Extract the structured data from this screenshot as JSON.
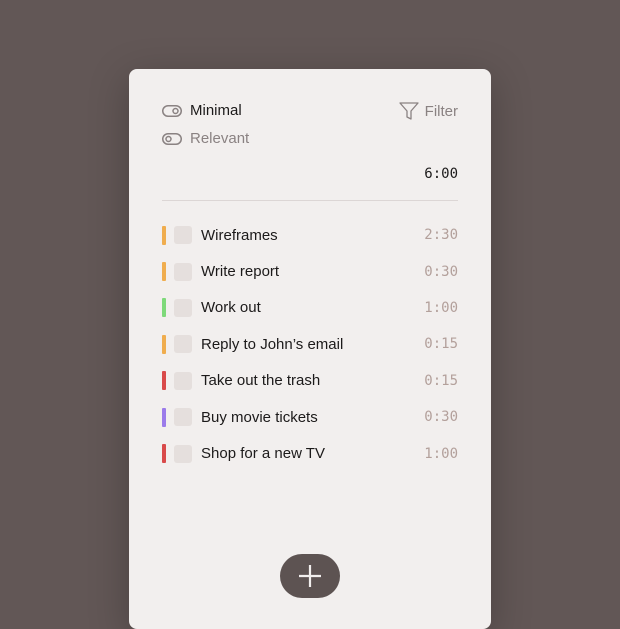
{
  "filters": {
    "minimal": "Minimal",
    "relevant": "Relevant",
    "filter": "Filter"
  },
  "total": "6:00",
  "tasks": [
    {
      "title": "Wireframes",
      "time": "2:30",
      "color": "#f0ad4e"
    },
    {
      "title": "Write report",
      "time": "0:30",
      "color": "#f0ad4e"
    },
    {
      "title": "Work out",
      "time": "1:00",
      "color": "#7ed97a"
    },
    {
      "title": "Reply to John’s email",
      "time": "0:15",
      "color": "#f0ad4e"
    },
    {
      "title": "Take out the trash",
      "time": "0:15",
      "color": "#d94a4a"
    },
    {
      "title": "Buy movie tickets",
      "time": "0:30",
      "color": "#9b7bea"
    },
    {
      "title": "Shop for a new TV",
      "time": "1:00",
      "color": "#d94a4a"
    }
  ],
  "icons": {
    "add": "plus-icon",
    "filter": "funnel-icon",
    "toggle": "toggle-icon"
  }
}
